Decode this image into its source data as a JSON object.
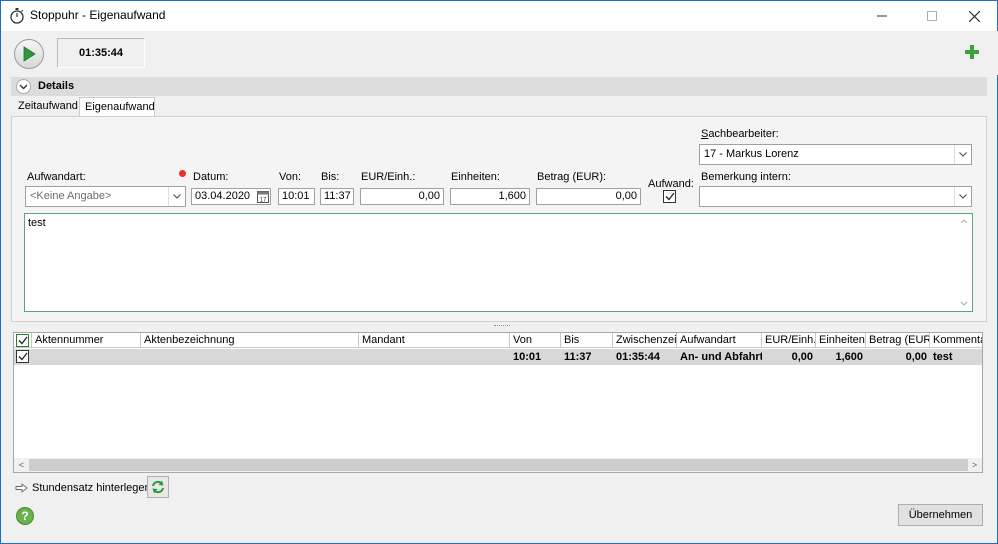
{
  "window": {
    "title": "Stoppuhr - Eigenaufwand",
    "icon": "stopwatch-icon"
  },
  "toolbar": {
    "timer": "01:35:44"
  },
  "details": {
    "label": "Details"
  },
  "tabs": [
    {
      "label": "Zeitaufwand",
      "active": false
    },
    {
      "label": "Eigenaufwand",
      "active": true
    }
  ],
  "form": {
    "sachbearbeiter_label": "Sachbearbeiter:",
    "sachbearbeiter_value": "17 - Markus Lorenz",
    "aufwandart_label": "Aufwandart:",
    "aufwandart_value": "<Keine Angabe>",
    "datum_label": "Datum:",
    "datum_value": "03.04.2020",
    "von_label": "Von:",
    "von_value": "10:01",
    "bis_label": "Bis:",
    "bis_value": "11:37",
    "eur_einh_label": "EUR/Einh.:",
    "eur_einh_value": "0,00",
    "einheiten_label": "Einheiten:",
    "einheiten_value": "1,600",
    "betrag_label": "Betrag (EUR):",
    "betrag_value": "0,00",
    "aufwand_label": "Aufwand:",
    "aufwand_checked": true,
    "bemerkung_label": "Bemerkung intern:",
    "bemerkung_value": "",
    "comment": "test"
  },
  "grid": {
    "columns": [
      "Aktennummer",
      "Aktenbezeichnung",
      "Mandant",
      "Von",
      "Bis",
      "Zwischenzeit",
      "Aufwandart",
      "EUR/Einh.",
      "Einheiten",
      "Betrag (EUR)",
      "Kommentar"
    ],
    "rows": [
      {
        "checked": true,
        "aktennummer": "",
        "aktenbezeichnung": "",
        "mandant": "",
        "von": "10:01",
        "bis": "11:37",
        "zwischenzeit": "01:35:44",
        "aufwandart": "An- und Abfahrt",
        "eur_einh": "0,00",
        "einheiten": "1,600",
        "betrag": "0,00",
        "kommentar": "test"
      }
    ]
  },
  "footer": {
    "stundensatz_label": "Stundensatz hinterlegen",
    "apply_label": "Übernehmen",
    "help_label": "?"
  },
  "colors": {
    "accent_green": "#2e9a3a",
    "window_border": "#1e6fc2",
    "required_dot": "#e8302c"
  }
}
